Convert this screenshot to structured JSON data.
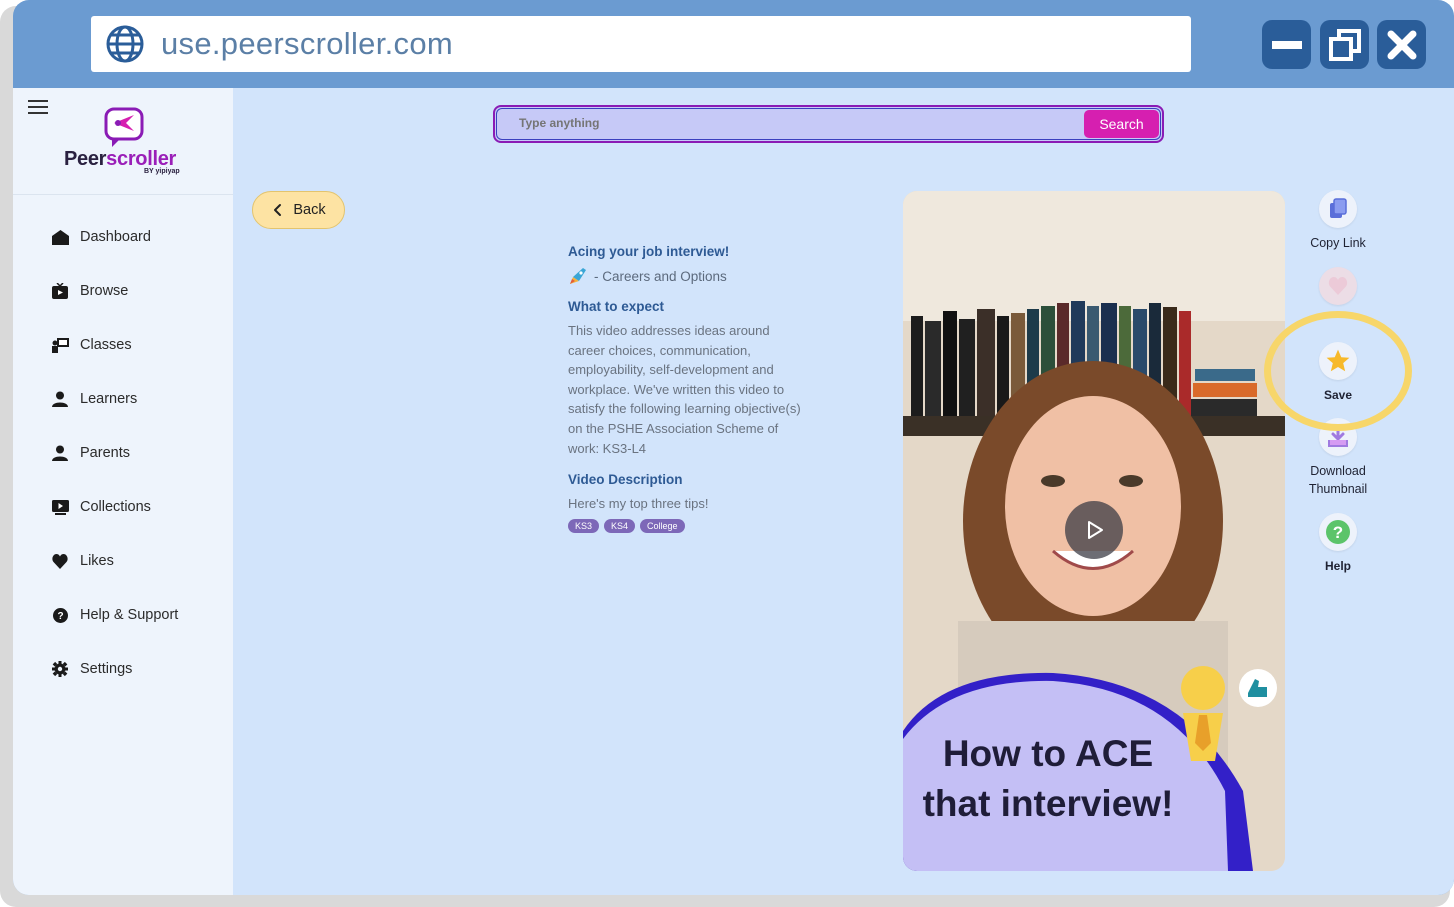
{
  "browser": {
    "url": "use.peerscroller.com",
    "controls": [
      "minimize",
      "restore",
      "close"
    ]
  },
  "sidebar": {
    "logo": {
      "name_main": "Peer",
      "name_accent": "scroller",
      "byline": "BY yipiyap"
    },
    "items": [
      {
        "label": "Dashboard",
        "icon": "home-icon"
      },
      {
        "label": "Browse",
        "icon": "tv-icon"
      },
      {
        "label": "Classes",
        "icon": "classes-icon"
      },
      {
        "label": "Learners",
        "icon": "person-icon"
      },
      {
        "label": "Parents",
        "icon": "person-icon"
      },
      {
        "label": "Collections",
        "icon": "play-rect-icon"
      },
      {
        "label": "Likes",
        "icon": "heart-icon"
      },
      {
        "label": "Help & Support",
        "icon": "question-circle-icon"
      },
      {
        "label": "Settings",
        "icon": "gear-icon"
      }
    ]
  },
  "search": {
    "placeholder": "Type anything",
    "button": "Search"
  },
  "back": {
    "label": "Back"
  },
  "details": {
    "title": "Acing your job interview!",
    "category": "- Careers and Options",
    "expect_heading": "What to expect",
    "expect_body": "This video addresses ideas around career choices, communication, employability, self-development and workplace. We've written this video to satisfy the following learning objective(s) on the PSHE Association Scheme of work: KS3-L4",
    "desc_heading": "Video Description",
    "desc_body": "Here's my top three tips!",
    "tags": [
      "KS3",
      "KS4",
      "College"
    ]
  },
  "video": {
    "title_line1": "How to ACE",
    "title_line2": "that interview!"
  },
  "actions": {
    "copy_link": "Copy Link",
    "like": "",
    "save": "Save",
    "download": "Download\nThumbnail",
    "help": "Help"
  },
  "colors": {
    "window_frame": "#6b9bd1",
    "window_buttons": "#2a5d99",
    "app_background": "#d2e4fb",
    "search_button": "#d61fb0",
    "back_button": "#fde3a3",
    "heading_blue": "#2e5a94",
    "tag": "#7d68b8",
    "highlight": "#f7d66a"
  }
}
